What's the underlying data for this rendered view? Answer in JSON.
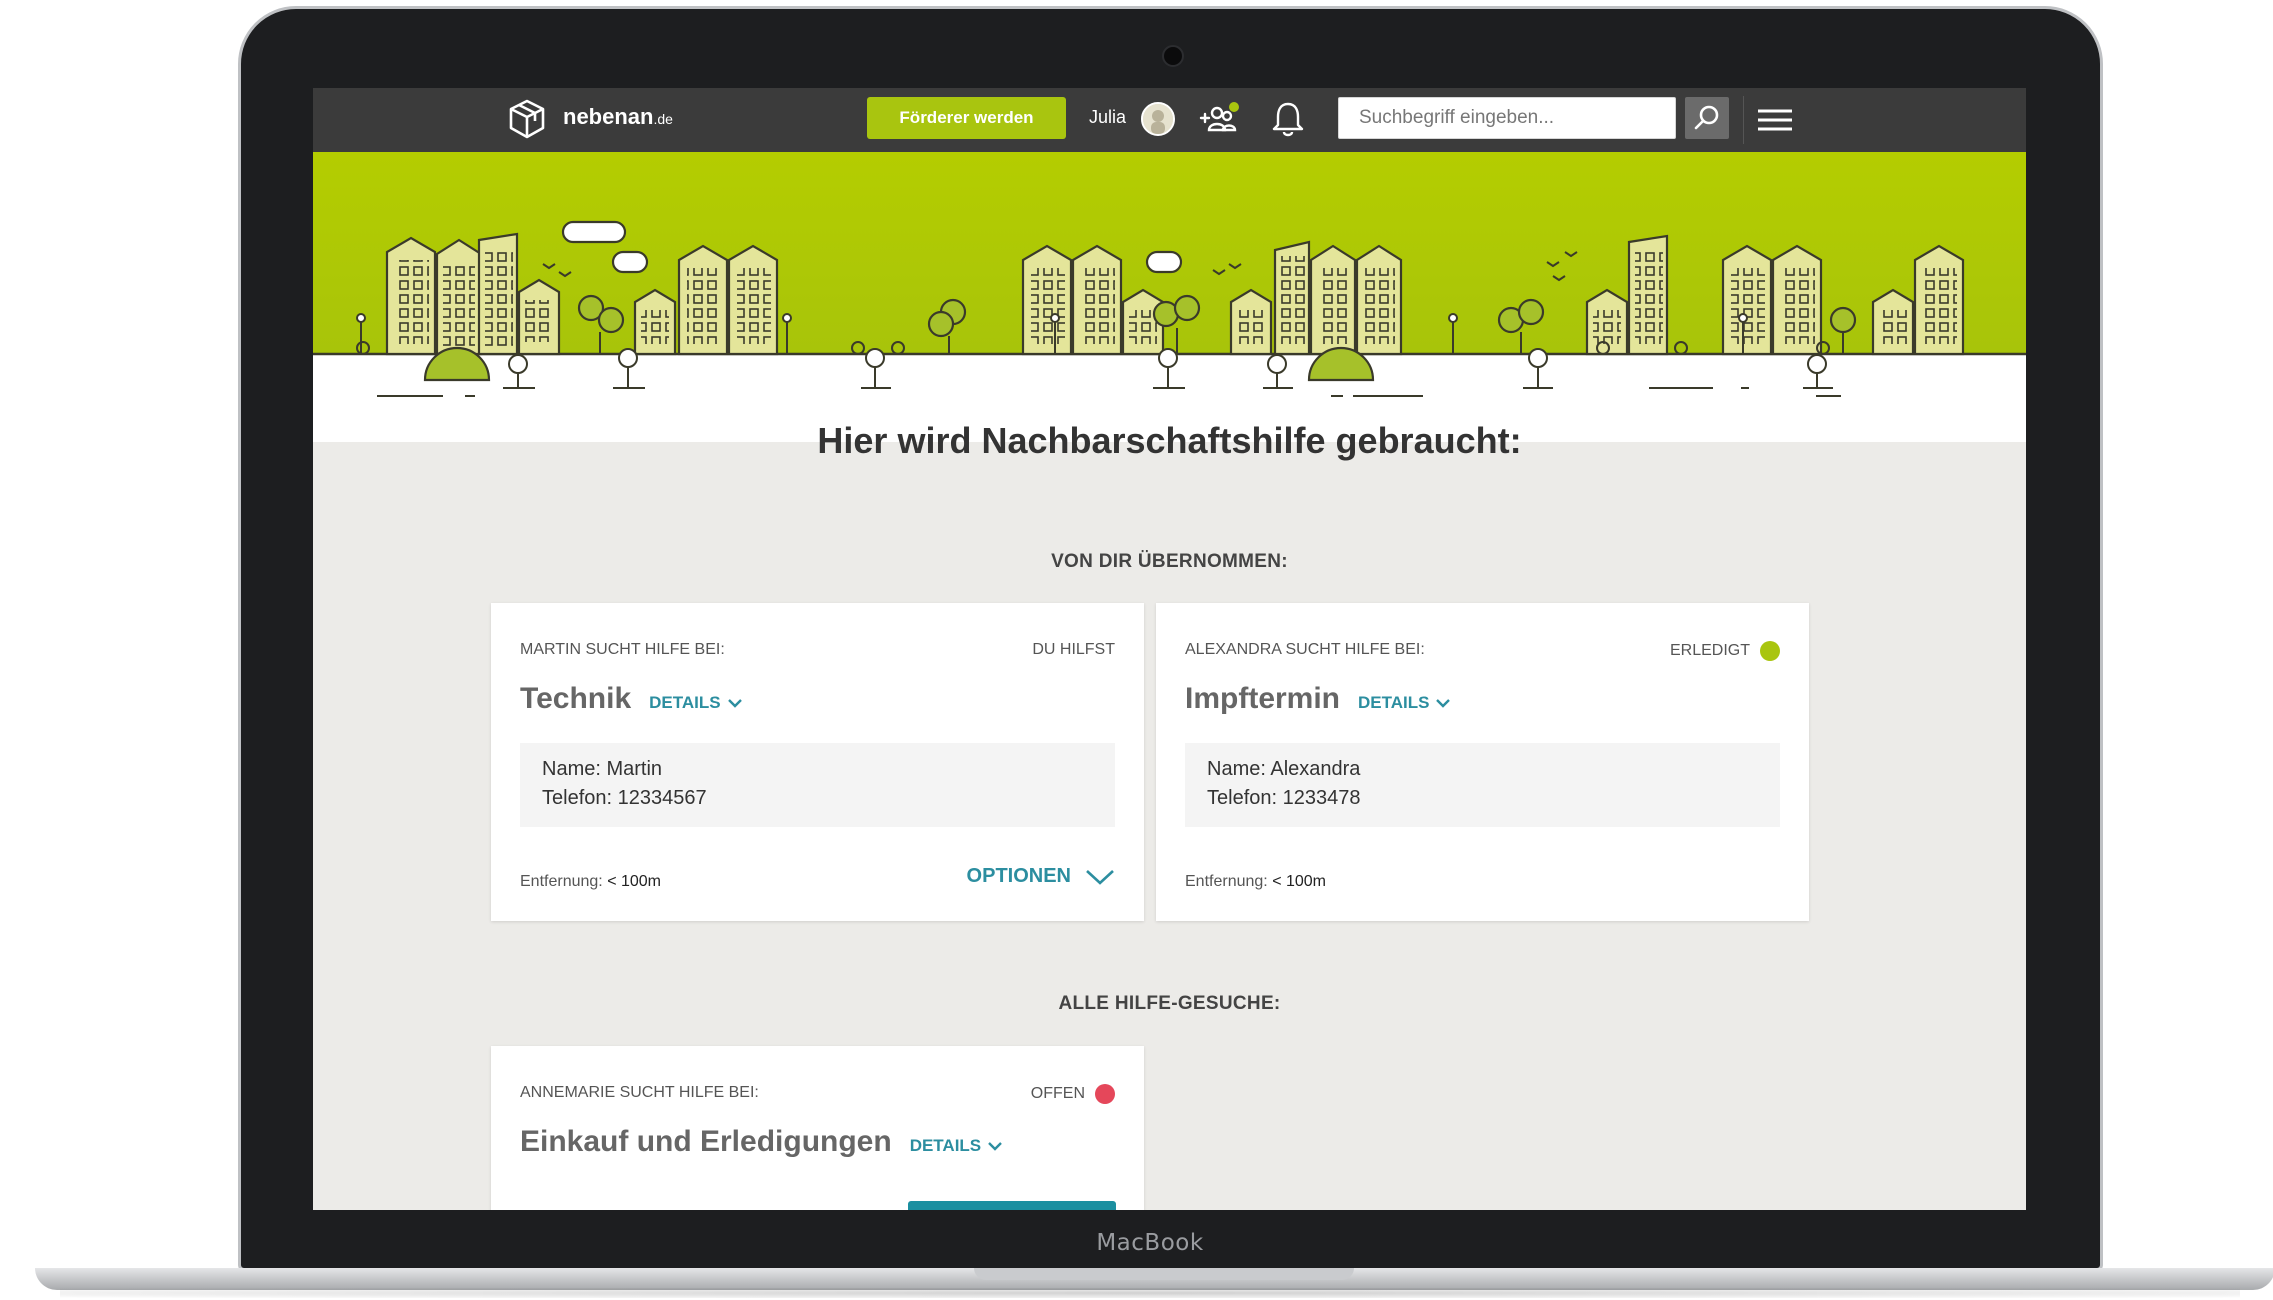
{
  "device": {
    "brand": "MacBook"
  },
  "nav": {
    "logo_text": "nebenan",
    "logo_tld": ".de",
    "cta_label": "Förderer werden",
    "user_name": "Julia",
    "search_placeholder": "Suchbegriff eingeben...",
    "icons": [
      "cube-logo-icon",
      "add-neighbor-icon",
      "bell-icon",
      "search-icon",
      "hamburger-menu-icon"
    ]
  },
  "hero": {
    "title": "Hier wird Nachbarschaftshilfe gebraucht:"
  },
  "taken": {
    "section_label": "VON DIR ÜBERNOMMEN:",
    "cards": [
      {
        "who": "MARTIN SUCHT HILFE BEI:",
        "status": "DU HILFST",
        "category": "Technik",
        "details_label": "DETAILS",
        "contact_name": "Name: Martin",
        "contact_phone": "Telefon: 12334567",
        "distance_label": "Entfernung:",
        "distance_value": "< 100m",
        "options_label": "OPTIONEN"
      },
      {
        "who": "ALEXANDRA SUCHT HILFE BEI:",
        "status": "ERLEDIGT",
        "status_color": "#a9c50f",
        "category": "Impftermin",
        "details_label": "DETAILS",
        "contact_name": "Name: Alexandra",
        "contact_phone": "Telefon: 1233478",
        "distance_label": "Entfernung:",
        "distance_value": "< 100m"
      }
    ]
  },
  "all": {
    "section_label": "ALLE HILFE-GESUCHE:",
    "cards": [
      {
        "who": "ANNEMARIE SUCHT HILFE BEI:",
        "status": "OFFEN",
        "status_color": "#e5475a",
        "category": "Einkauf und Erledigungen",
        "details_label": "DETAILS"
      }
    ]
  },
  "colors": {
    "brand_green": "#a9c50f",
    "link_teal": "#2c8ea0",
    "nav_bg": "#3b3b3b",
    "page_bg": "#ecebe8"
  }
}
